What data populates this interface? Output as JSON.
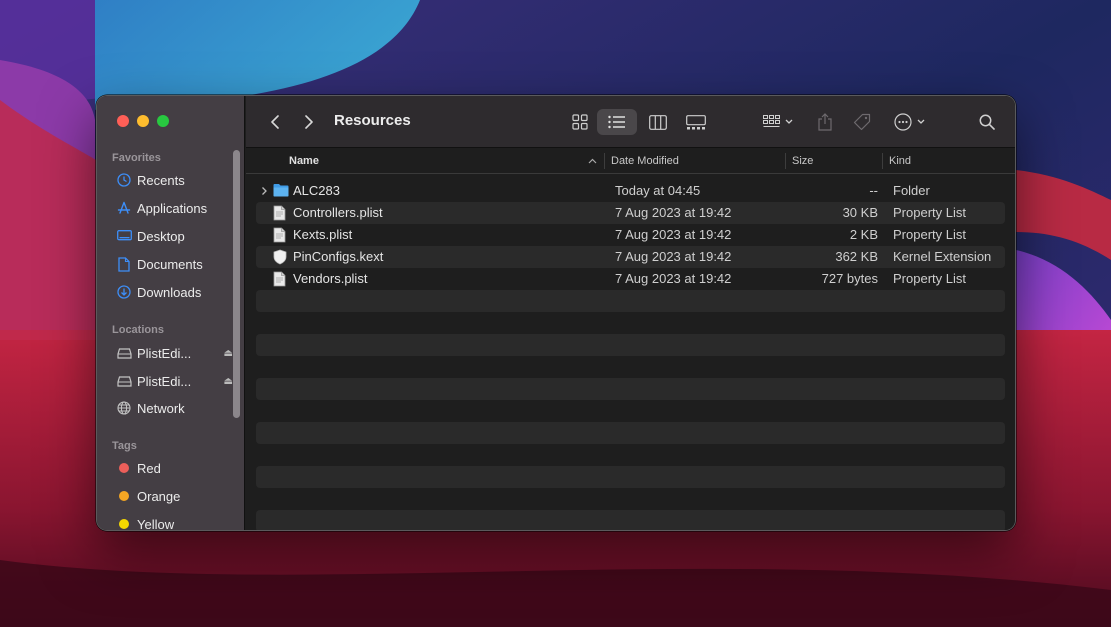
{
  "window": {
    "title": "Resources"
  },
  "sidebar": {
    "favorites": {
      "heading": "Favorites",
      "items": [
        {
          "label": "Recents",
          "icon": "clock-icon"
        },
        {
          "label": "Applications",
          "icon": "applications-icon"
        },
        {
          "label": "Desktop",
          "icon": "desktop-icon"
        },
        {
          "label": "Documents",
          "icon": "document-icon"
        },
        {
          "label": "Downloads",
          "icon": "download-icon"
        }
      ]
    },
    "locations": {
      "heading": "Locations",
      "items": [
        {
          "label": "PlistEdi...",
          "icon": "drive-icon",
          "eject": "⏏"
        },
        {
          "label": "PlistEdi...",
          "icon": "drive-icon",
          "eject": "⏏"
        },
        {
          "label": "Network",
          "icon": "globe-icon"
        }
      ]
    },
    "tags": {
      "heading": "Tags",
      "items": [
        {
          "label": "Red",
          "color": "#ec5f5a"
        },
        {
          "label": "Orange",
          "color": "#f5a623"
        },
        {
          "label": "Yellow",
          "color": "#f5d800"
        }
      ]
    }
  },
  "columns": {
    "name": "Name",
    "date": "Date Modified",
    "size": "Size",
    "kind": "Kind"
  },
  "files": [
    {
      "name": "ALC283",
      "date": "Today at 04:45",
      "size": "--",
      "kind": "Folder",
      "icon": "folder-icon"
    },
    {
      "name": "Controllers.plist",
      "date": "7 Aug 2023 at 19:42",
      "size": "30 KB",
      "kind": "Property List",
      "icon": "plist-file-icon"
    },
    {
      "name": "Kexts.plist",
      "date": "7 Aug 2023 at 19:42",
      "size": "2 KB",
      "kind": "Property List",
      "icon": "plist-file-icon"
    },
    {
      "name": "PinConfigs.kext",
      "date": "7 Aug 2023 at 19:42",
      "size": "362 KB",
      "kind": "Kernel Extension",
      "icon": "kext-shield-icon"
    },
    {
      "name": "Vendors.plist",
      "date": "7 Aug 2023 at 19:42",
      "size": "727 bytes",
      "kind": "Property List",
      "icon": "plist-file-icon"
    }
  ],
  "colors": {
    "accent": "#3d8ef8",
    "folder": "#5db3f0"
  }
}
